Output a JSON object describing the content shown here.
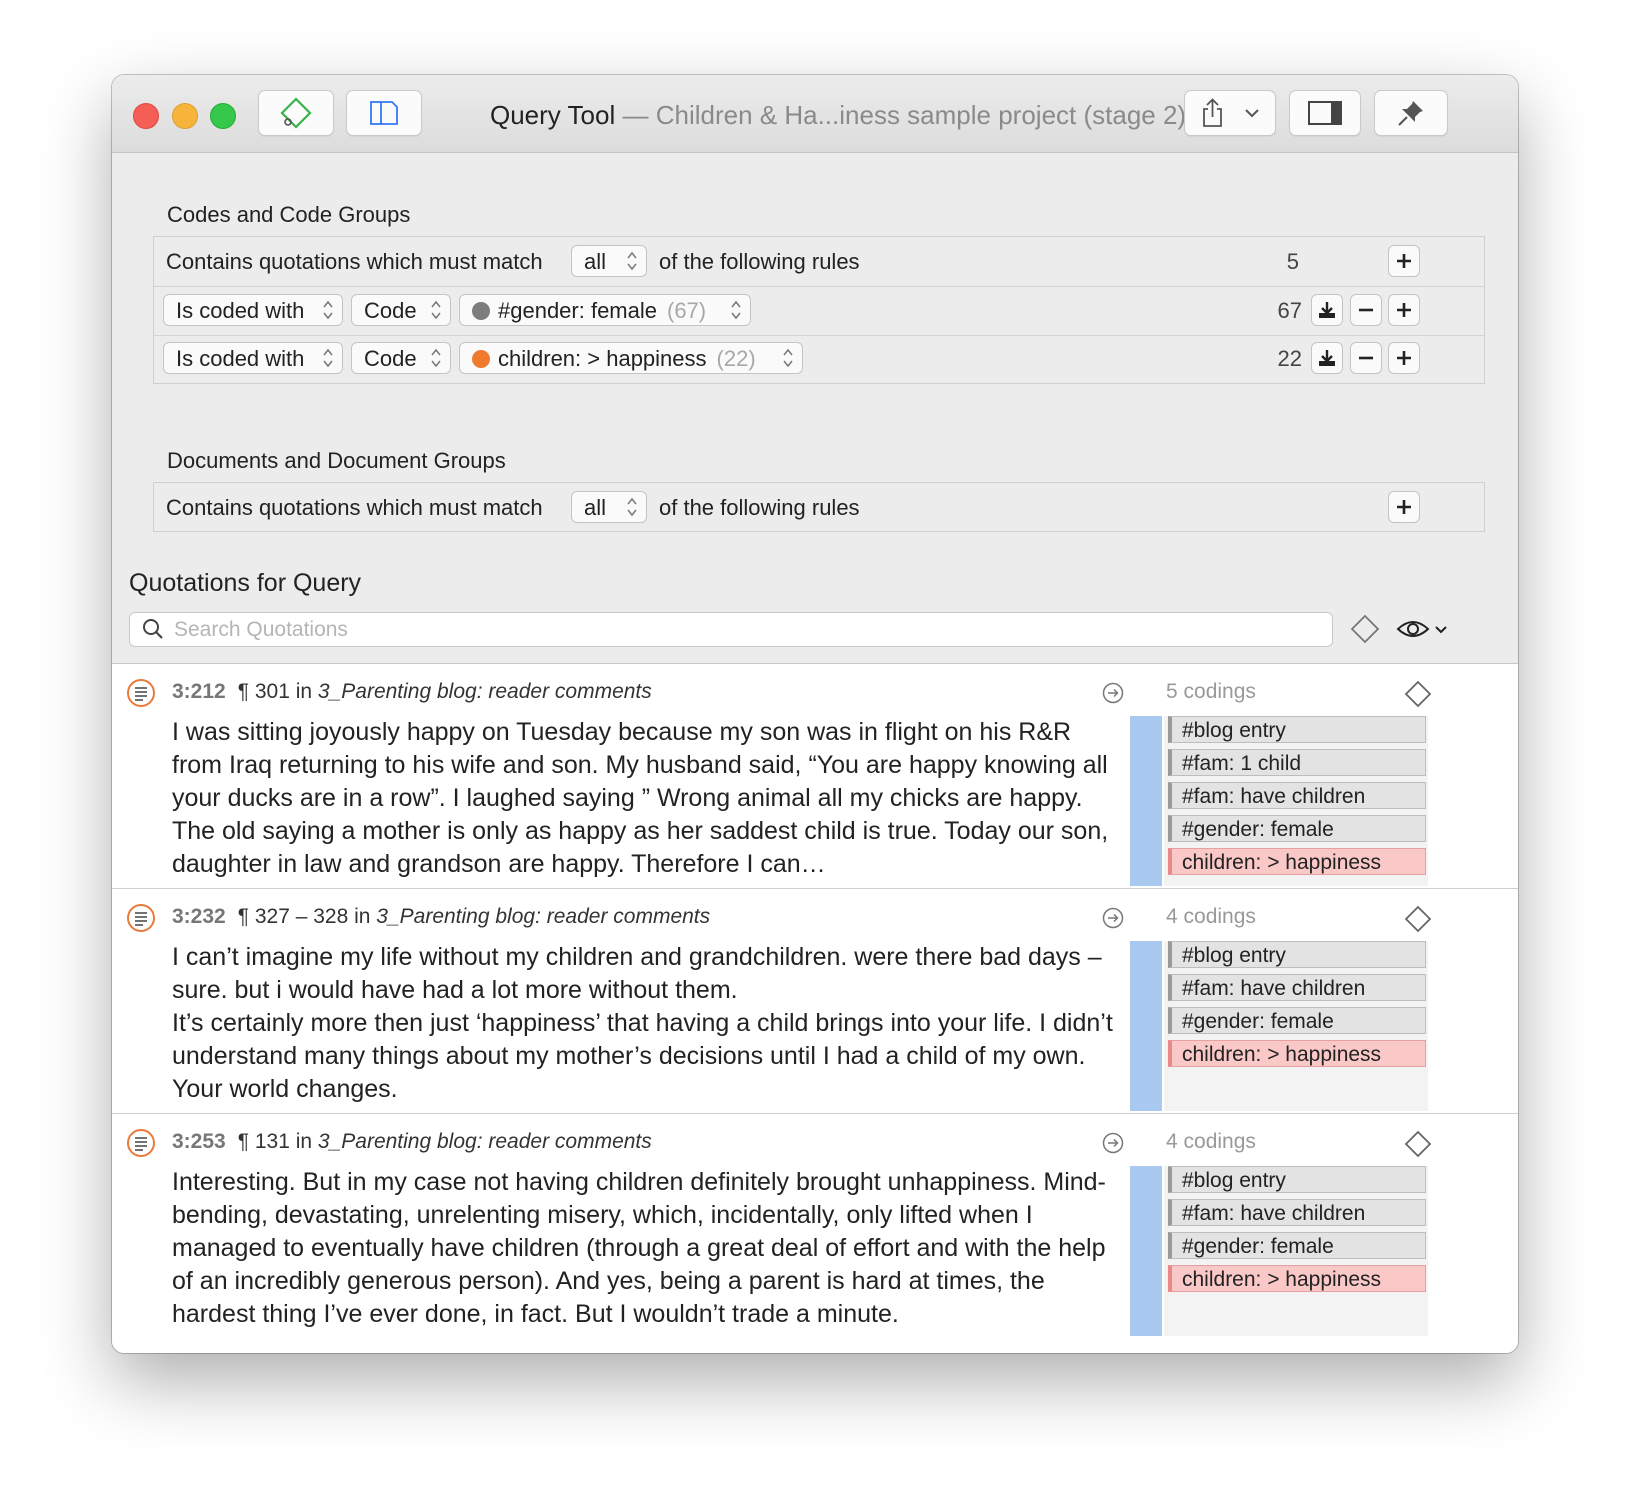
{
  "window": {
    "title": "Query Tool",
    "title_separator": "—",
    "project_name": "Children & Ha...iness sample project (stage 2)"
  },
  "colors": {
    "close": "#f45e55",
    "minimize": "#f6b53a",
    "zoom": "#35c84a",
    "highlight_tag": "#fbc8c8",
    "code_bar": "#a9c9f1",
    "orange_code": "#ef7a2e",
    "gray_code": "#8a8a8a"
  },
  "codes_section": {
    "title": "Codes and Code Groups",
    "header": {
      "prefix": "Contains quotations which must match",
      "match_mode": "all",
      "suffix": "of the following rules",
      "count": "5"
    },
    "rules": [
      {
        "condition": "Is coded with",
        "type": "Code",
        "code_name": "#gender: female",
        "code_count": "(67)",
        "dot_color": "#7d7d7d",
        "count": "67"
      },
      {
        "condition": "Is coded with",
        "type": "Code",
        "code_name": "children: > happiness",
        "code_count": "(22)",
        "dot_color": "#ef7a2e",
        "count": "22"
      }
    ]
  },
  "documents_section": {
    "title": "Documents and Document Groups",
    "header": {
      "prefix": "Contains quotations which must match",
      "match_mode": "all",
      "suffix": "of the following rules"
    }
  },
  "quotations": {
    "title": "Quotations for Query",
    "search_placeholder": "Search Quotations",
    "items": [
      {
        "id": "3:212",
        "para": "¶ 301 in",
        "doc": "3_Parenting blog: reader comments",
        "text": "I was sitting joyously happy on Tuesday because my son was in flight on his R&R from Iraq returning to his wife and son. My husband said, “You are happy knowing all your ducks are in a row”. I laughed saying ” Wrong animal all my chicks are happy. The old saying a mother is only as happy as her saddest child is true. Today our son, daughter in law and grandson are happy. Therefore I can…",
        "codings": "5 codings",
        "tags": [
          "#blog entry",
          "#fam: 1 child",
          "#fam: have children",
          "#gender: female",
          "children: > happiness"
        ]
      },
      {
        "id": "3:232",
        "para": "¶ 327 – 328 in",
        "doc": "3_Parenting blog: reader comments",
        "text": "I can’t imagine my life without my children and grandchildren. were there bad days – sure. but i would have had a lot more without them.\nIt’s certainly more then just ‘happiness’ that having a child brings into your life. I didn’t understand many things about my mother’s decisions until I had a child of my own. Your world changes.",
        "codings": "4 codings",
        "tags": [
          "#blog entry",
          "#fam: have children",
          "#gender: female",
          "children: > happiness"
        ]
      },
      {
        "id": "3:253",
        "para": "¶ 131 in",
        "doc": "3_Parenting blog: reader comments",
        "text": "Interesting. But in my case not having children definitely brought unhappiness. Mind-bending, devastating, unrelenting misery, which, incidentally, only lifted when I managed to eventually have children (through a great deal of effort and with the help of an incredibly generous person). And yes, being a parent is hard at times, the hardest thing I’ve ever done, in fact. But I wouldn’t trade a minute.",
        "codings": "4 codings",
        "tags": [
          "#blog entry",
          "#fam: have children",
          "#gender: female",
          "children: > happiness"
        ]
      }
    ]
  }
}
